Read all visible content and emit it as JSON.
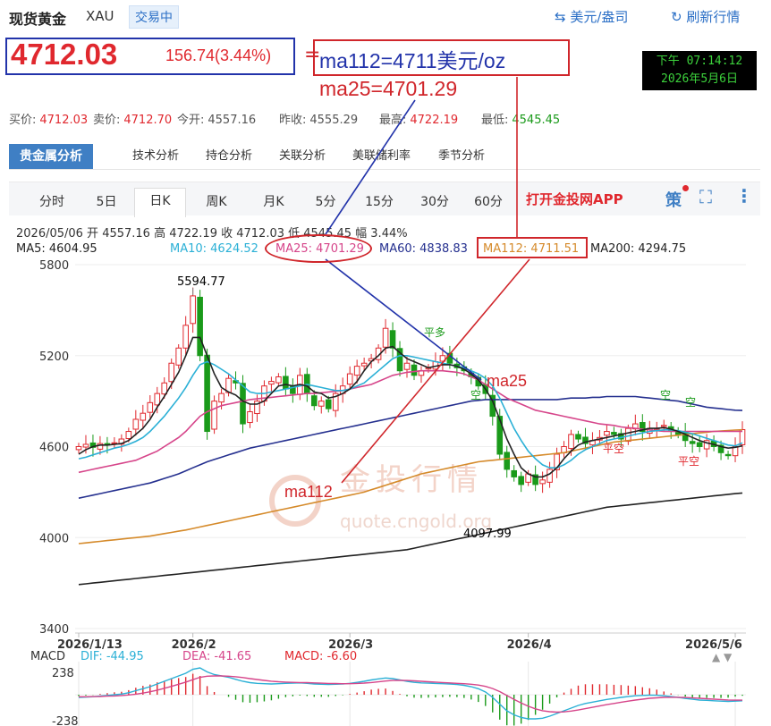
{
  "header": {
    "title": "现货黄金",
    "symbol": "XAU",
    "status": "交易中",
    "unit_button": "美元/盎司",
    "refresh_button": "刷新行情"
  },
  "price": {
    "last": "4712.03",
    "change": "156.74(3.44%)"
  },
  "annotations": {
    "eq": "=",
    "ma112_note": "ma112=4711美元/oz",
    "ma25_note": "ma25=4701.29",
    "ma25_chart": "ma25",
    "ma112_chart": "ma112"
  },
  "clock": {
    "time": "下午 07:14:12",
    "date": "2026年5月6日"
  },
  "quotes": [
    {
      "label": "买价:",
      "value": "4712.03",
      "color": "red"
    },
    {
      "label": "卖价:",
      "value": "4712.70",
      "color": "red"
    },
    {
      "label": "今开:",
      "value": "4557.16",
      "color": "plain"
    },
    {
      "label": "昨收:",
      "value": "4555.29",
      "color": "plain"
    },
    {
      "label": "最高:",
      "value": "4722.19",
      "color": "red"
    },
    {
      "label": "最低:",
      "value": "4545.45",
      "color": "green"
    }
  ],
  "tabs": [
    "贵金属分析",
    "技术分析",
    "持仓分析",
    "关联分析",
    "美联储利率",
    "季节分析"
  ],
  "periods": [
    "分时",
    "5日",
    "日K",
    "周K",
    "月K",
    "5分",
    "15分",
    "30分",
    "60分"
  ],
  "toolbar": {
    "app_link": "打开金投网APP",
    "strategy": "策",
    "fullscreen_icon": "⛶",
    "more_icon": "⋮"
  },
  "ohlc_line": "2026/05/06 开 4557.16 高 4722.19 收 4712.03 低 4545.45 幅 3.44%",
  "ma_values": [
    {
      "label": "MA5: 4604.95",
      "color": "#222222"
    },
    {
      "label": "MA10: 4624.52",
      "color": "#2bb0d6"
    },
    {
      "label": "MA25: 4701.29",
      "color": "#d6458a"
    },
    {
      "label": "MA60: 4838.83",
      "color": "#25308f"
    },
    {
      "label": "MA112: 4711.51",
      "color": "#d58a2a"
    },
    {
      "label": "MA200: 4294.75",
      "color": "#222222"
    }
  ],
  "watermark": {
    "name": "金投行情",
    "url": "quote.cngold.org"
  },
  "marker_labels": {
    "max": "5594.77",
    "min": "4097.99",
    "signals": [
      "平多",
      "空",
      "平空",
      "空",
      "空",
      "平空"
    ]
  },
  "macd": {
    "label": "MACD",
    "dif": "DIF: -44.95",
    "dea": "DEA: -41.65",
    "macd": "MACD: -6.60",
    "upper": "238",
    "lower": "-238"
  },
  "chart_data": {
    "type": "candlestick",
    "y_ticks": [
      "5800",
      "5200",
      "4600",
      "4000",
      "3400"
    ],
    "ylim": [
      3400,
      5800
    ],
    "x_ticks": [
      "2026/1/13",
      "2026/2",
      "2026/3",
      "2026/4",
      "2026/5/6"
    ],
    "x_tick_index": [
      0,
      16,
      38,
      63,
      92
    ],
    "colors": {
      "up": "#e0282e",
      "down": "#1a9a1a"
    },
    "close": [
      4600,
      4615,
      4595,
      4620,
      4610,
      4625,
      4650,
      4700,
      4780,
      4820,
      4890,
      4950,
      5020,
      5150,
      5250,
      5400,
      5594,
      5200,
      4700,
      4900,
      4950,
      5050,
      5020,
      4750,
      4830,
      4900,
      5000,
      5030,
      5060,
      4980,
      4950,
      5070,
      4950,
      4870,
      4900,
      4850,
      4950,
      5000,
      5080,
      5130,
      5150,
      5180,
      5250,
      5380,
      5250,
      5100,
      5150,
      5070,
      5100,
      5120,
      5160,
      5200,
      5150,
      5120,
      5100,
      5060,
      5000,
      4950,
      4800,
      4550,
      4450,
      4400,
      4350,
      4420,
      4350,
      4380,
      4450,
      4550,
      4600,
      4680,
      4650,
      4620,
      4640,
      4660,
      4700,
      4680,
      4650,
      4720,
      4750,
      4700,
      4720,
      4720,
      4740,
      4700,
      4680,
      4640,
      4620,
      4600,
      4640,
      4600,
      4560,
      4540,
      4600,
      4712
    ],
    "ma5": [
      4550,
      4580,
      4600,
      4610,
      4610,
      4615,
      4620,
      4640,
      4680,
      4720,
      4780,
      4860,
      4930,
      5010,
      5090,
      5200,
      5320,
      5320,
      5200,
      5080,
      4990,
      4960,
      4940,
      4900,
      4880,
      4880,
      4900,
      4950,
      5000,
      5010,
      5000,
      5010,
      5000,
      4960,
      4950,
      4920,
      4930,
      4950,
      4980,
      5030,
      5100,
      5160,
      5200,
      5250,
      5260,
      5220,
      5180,
      5160,
      5140,
      5120,
      5130,
      5140,
      5140,
      5130,
      5110,
      5080,
      5040,
      4980,
      4900,
      4780,
      4650,
      4550,
      4460,
      4420,
      4400,
      4400,
      4420,
      4460,
      4520,
      4570,
      4610,
      4630,
      4640,
      4650,
      4660,
      4670,
      4680,
      4690,
      4700,
      4710,
      4720,
      4720,
      4725,
      4715,
      4700,
      4680,
      4660,
      4640,
      4625,
      4615,
      4600,
      4590,
      4595,
      4605
    ],
    "ma10": [
      4520,
      4530,
      4545,
      4560,
      4575,
      4590,
      4600,
      4615,
      4635,
      4660,
      4700,
      4750,
      4800,
      4860,
      4920,
      4990,
      5070,
      5140,
      5160,
      5140,
      5110,
      5080,
      5040,
      5000,
      4960,
      4950,
      4950,
      4960,
      4970,
      4980,
      4990,
      5000,
      5010,
      5000,
      4990,
      4980,
      4970,
      4970,
      4980,
      5000,
      5020,
      5060,
      5100,
      5140,
      5180,
      5200,
      5200,
      5190,
      5180,
      5170,
      5160,
      5150,
      5140,
      5130,
      5120,
      5100,
      5080,
      5050,
      5000,
      4920,
      4820,
      4720,
      4640,
      4570,
      4520,
      4480,
      4460,
      4460,
      4480,
      4510,
      4550,
      4580,
      4600,
      4620,
      4640,
      4650,
      4660,
      4670,
      4680,
      4690,
      4700,
      4705,
      4710,
      4710,
      4705,
      4695,
      4685,
      4670,
      4655,
      4640,
      4625,
      4610,
      4605,
      4624
    ],
    "ma25": [
      4430,
      4440,
      4450,
      4460,
      4470,
      4480,
      4490,
      4500,
      4510,
      4530,
      4550,
      4570,
      4600,
      4630,
      4660,
      4700,
      4750,
      4800,
      4830,
      4850,
      4870,
      4880,
      4890,
      4900,
      4910,
      4915,
      4920,
      4925,
      4930,
      4935,
      4940,
      4945,
      4950,
      4950,
      4955,
      4960,
      4965,
      4970,
      4980,
      4990,
      5000,
      5010,
      5030,
      5050,
      5070,
      5080,
      5090,
      5095,
      5100,
      5100,
      5100,
      5100,
      5095,
      5090,
      5080,
      5060,
      5040,
      5010,
      4980,
      4950,
      4920,
      4900,
      4880,
      4860,
      4840,
      4830,
      4820,
      4810,
      4800,
      4790,
      4780,
      4770,
      4760,
      4750,
      4745,
      4740,
      4730,
      4725,
      4720,
      4715,
      4710,
      4705,
      4700,
      4700,
      4700,
      4700,
      4700,
      4700,
      4700,
      4700,
      4700,
      4700,
      4700,
      4701
    ],
    "ma60": [
      4260,
      4270,
      4280,
      4290,
      4300,
      4310,
      4320,
      4330,
      4340,
      4350,
      4360,
      4375,
      4390,
      4405,
      4420,
      4440,
      4460,
      4480,
      4500,
      4515,
      4530,
      4545,
      4560,
      4575,
      4590,
      4600,
      4610,
      4620,
      4630,
      4640,
      4650,
      4660,
      4670,
      4680,
      4690,
      4700,
      4710,
      4720,
      4730,
      4740,
      4750,
      4760,
      4770,
      4780,
      4790,
      4800,
      4810,
      4820,
      4830,
      4840,
      4850,
      4860,
      4870,
      4880,
      4890,
      4900,
      4905,
      4910,
      4910,
      4910,
      4910,
      4910,
      4910,
      4910,
      4910,
      4910,
      4910,
      4910,
      4915,
      4920,
      4920,
      4920,
      4925,
      4925,
      4930,
      4930,
      4930,
      4930,
      4930,
      4925,
      4920,
      4915,
      4910,
      4905,
      4900,
      4890,
      4880,
      4870,
      4860,
      4855,
      4850,
      4845,
      4840,
      4838
    ],
    "ma112": [
      3960,
      3965,
      3970,
      3975,
      3980,
      3985,
      3990,
      3995,
      4000,
      4005,
      4010,
      4018,
      4026,
      4034,
      4042,
      4050,
      4060,
      4070,
      4080,
      4090,
      4100,
      4110,
      4120,
      4130,
      4140,
      4150,
      4160,
      4170,
      4180,
      4190,
      4200,
      4210,
      4220,
      4230,
      4240,
      4250,
      4260,
      4270,
      4280,
      4290,
      4300,
      4315,
      4330,
      4345,
      4360,
      4375,
      4390,
      4405,
      4420,
      4430,
      4440,
      4450,
      4460,
      4470,
      4480,
      4490,
      4500,
      4505,
      4510,
      4515,
      4520,
      4525,
      4530,
      4535,
      4540,
      4545,
      4550,
      4555,
      4560,
      4570,
      4580,
      4590,
      4600,
      4610,
      4620,
      4630,
      4635,
      4640,
      4645,
      4650,
      4655,
      4660,
      4665,
      4670,
      4675,
      4680,
      4685,
      4690,
      4695,
      4700,
      4703,
      4706,
      4709,
      4711
    ],
    "ma200": [
      3690,
      3695,
      3700,
      3705,
      3710,
      3715,
      3720,
      3725,
      3730,
      3735,
      3740,
      3745,
      3750,
      3755,
      3760,
      3765,
      3770,
      3775,
      3780,
      3785,
      3790,
      3795,
      3800,
      3805,
      3810,
      3815,
      3820,
      3825,
      3830,
      3835,
      3840,
      3845,
      3850,
      3855,
      3860,
      3865,
      3870,
      3875,
      3880,
      3885,
      3890,
      3895,
      3900,
      3905,
      3910,
      3915,
      3920,
      3930,
      3940,
      3950,
      3960,
      3970,
      3980,
      3990,
      4000,
      4010,
      4020,
      4030,
      4040,
      4050,
      4060,
      4070,
      4080,
      4090,
      4100,
      4110,
      4120,
      4130,
      4140,
      4150,
      4160,
      4170,
      4180,
      4190,
      4200,
      4205,
      4210,
      4215,
      4220,
      4225,
      4230,
      4235,
      4240,
      4245,
      4250,
      4255,
      4260,
      4265,
      4270,
      4275,
      4280,
      4285,
      4290,
      4294
    ],
    "macd_dif": [
      -20,
      -18,
      -15,
      -10,
      -5,
      0,
      5,
      15,
      30,
      45,
      60,
      80,
      100,
      120,
      140,
      160,
      190,
      200,
      170,
      150,
      140,
      130,
      115,
      100,
      90,
      85,
      82,
      80,
      82,
      85,
      86,
      88,
      85,
      80,
      78,
      76,
      78,
      80,
      85,
      92,
      100,
      110,
      118,
      125,
      120,
      110,
      100,
      92,
      88,
      86,
      84,
      82,
      80,
      76,
      70,
      60,
      45,
      20,
      -20,
      -70,
      -120,
      -150,
      -170,
      -180,
      -180,
      -175,
      -160,
      -140,
      -120,
      -100,
      -80,
      -65,
      -55,
      -45,
      -35,
      -28,
      -20,
      -14,
      -8,
      -5,
      -3,
      -4,
      -8,
      -14,
      -20,
      -28,
      -34,
      -40,
      -42,
      -45,
      -48,
      -50,
      -48,
      -45
    ],
    "macd_dea": [
      -15,
      -15,
      -14,
      -13,
      -11,
      -9,
      -6,
      -2,
      4,
      12,
      22,
      34,
      48,
      62,
      78,
      94,
      112,
      130,
      138,
      140,
      140,
      138,
      134,
      128,
      120,
      113,
      107,
      101,
      97,
      94,
      92,
      91,
      90,
      88,
      86,
      84,
      83,
      82,
      82,
      84,
      87,
      91,
      96,
      102,
      106,
      107,
      106,
      103,
      100,
      97,
      94,
      91,
      88,
      85,
      82,
      78,
      72,
      62,
      46,
      23,
      -6,
      -35,
      -62,
      -86,
      -105,
      -119,
      -127,
      -130,
      -128,
      -122,
      -114,
      -104,
      -94,
      -84,
      -74,
      -65,
      -56,
      -48,
      -40,
      -33,
      -27,
      -23,
      -20,
      -19,
      -19,
      -21,
      -24,
      -27,
      -30,
      -33,
      -36,
      -39,
      -41,
      -41
    ]
  }
}
